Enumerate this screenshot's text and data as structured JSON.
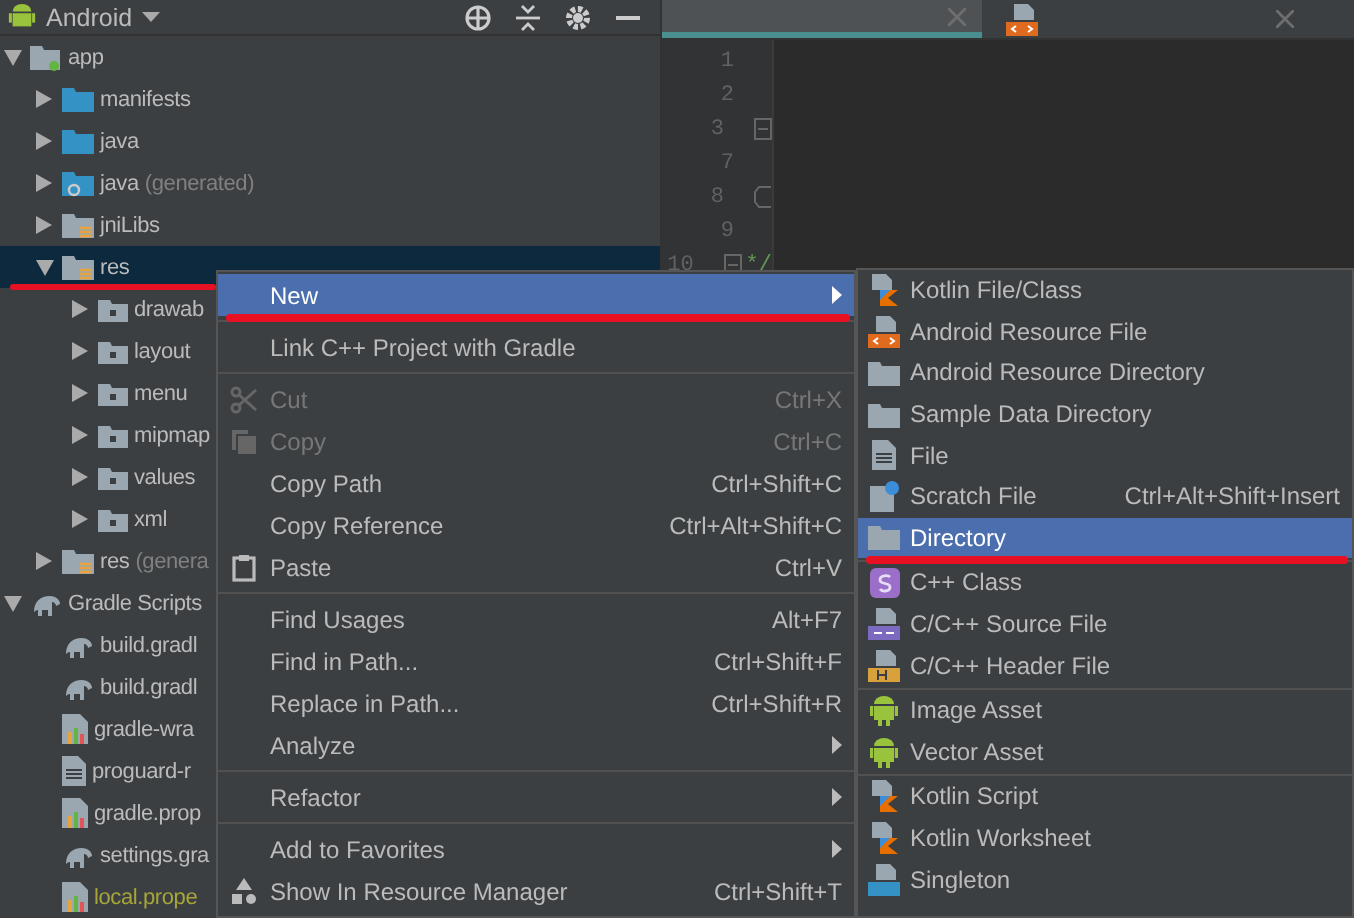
{
  "project_panel": {
    "view_selector": "Android",
    "tree": [
      {
        "label": "app",
        "kind": "module",
        "expanded": true,
        "selected": false,
        "children": [
          {
            "label": "manifests",
            "kind": "folder",
            "expanded": false,
            "selected": false
          },
          {
            "label": "java",
            "kind": "folder",
            "expanded": false,
            "selected": false
          },
          {
            "label": "java",
            "hint": "(generated)",
            "kind": "folder-generated",
            "expanded": false,
            "selected": false
          },
          {
            "label": "jniLibs",
            "kind": "folder-resource",
            "expanded": false,
            "selected": false
          },
          {
            "label": "res",
            "kind": "folder-resource",
            "expanded": true,
            "selected": true,
            "annotated": true,
            "children": [
              {
                "label": "drawab",
                "kind": "package",
                "expanded": false,
                "selected": false
              },
              {
                "label": "layout",
                "kind": "package",
                "expanded": false,
                "selected": false
              },
              {
                "label": "menu",
                "kind": "package",
                "expanded": false,
                "selected": false
              },
              {
                "label": "mipmap",
                "kind": "package",
                "expanded": false,
                "selected": false
              },
              {
                "label": "values",
                "kind": "package",
                "expanded": false,
                "selected": false
              },
              {
                "label": "xml",
                "kind": "package",
                "expanded": false,
                "selected": false
              }
            ]
          },
          {
            "label": "res",
            "hint": "(genera",
            "kind": "folder-resource",
            "expanded": false,
            "selected": false
          }
        ]
      },
      {
        "label": "Gradle Scripts",
        "kind": "gradle",
        "expanded": true,
        "selected": false,
        "children": [
          {
            "label": "build.gradl",
            "kind": "gradle",
            "selected": false
          },
          {
            "label": "build.gradl",
            "kind": "gradle",
            "selected": false
          },
          {
            "label": "gradle-wra",
            "kind": "properties",
            "selected": false
          },
          {
            "label": "proguard-r",
            "kind": "file",
            "selected": false
          },
          {
            "label": "gradle.prop",
            "kind": "properties",
            "selected": false
          },
          {
            "label": "settings.gra",
            "kind": "gradle",
            "selected": false
          },
          {
            "label": "local.prope",
            "kind": "properties",
            "selected": false,
            "ignored": true
          }
        ]
      }
    ]
  },
  "editor": {
    "tabs": [
      {
        "selected": true,
        "kind": "plain"
      },
      {
        "selected": false,
        "kind": "xml"
      }
    ],
    "lines": [
      {
        "number": "1",
        "kind": "plain"
      },
      {
        "number": "2",
        "kind": "plain"
      },
      {
        "number": "3",
        "kind": "fold-start"
      },
      {
        "number": "7",
        "kind": "plain"
      },
      {
        "number": "8",
        "kind": "fold-close"
      },
      {
        "number": "9",
        "kind": "plain"
      },
      {
        "number": "10",
        "kind": "fold-start",
        "code": "*/"
      }
    ]
  },
  "context_menu": {
    "items": [
      {
        "kind": "plain",
        "label": "New",
        "submenu": true,
        "selected": true,
        "disabled": false,
        "annotated": true
      },
      {
        "kind": "separator"
      },
      {
        "kind": "plain",
        "label": "Link C++ Project with Gradle",
        "selected": false,
        "disabled": false
      },
      {
        "kind": "separator"
      },
      {
        "kind": "scissors",
        "label": "Cut",
        "shortcut": "Ctrl+X",
        "selected": false,
        "disabled": true
      },
      {
        "kind": "copy",
        "label": "Copy",
        "shortcut": "Ctrl+C",
        "selected": false,
        "disabled": true
      },
      {
        "kind": "plain",
        "label": "Copy Path",
        "shortcut": "Ctrl+Shift+C",
        "selected": false,
        "disabled": false
      },
      {
        "kind": "plain",
        "label": "Copy Reference",
        "shortcut": "Ctrl+Alt+Shift+C",
        "selected": false,
        "disabled": false
      },
      {
        "kind": "clipboard",
        "label": "Paste",
        "shortcut": "Ctrl+V",
        "selected": false,
        "disabled": false
      },
      {
        "kind": "separator"
      },
      {
        "kind": "plain",
        "label": "Find Usages",
        "shortcut": "Alt+F7",
        "selected": false,
        "disabled": false
      },
      {
        "kind": "plain",
        "label": "Find in Path...",
        "shortcut": "Ctrl+Shift+F",
        "selected": false,
        "disabled": false
      },
      {
        "kind": "plain",
        "label": "Replace in Path...",
        "shortcut": "Ctrl+Shift+R",
        "selected": false,
        "disabled": false
      },
      {
        "kind": "plain",
        "label": "Analyze",
        "submenu": true,
        "selected": false,
        "disabled": false
      },
      {
        "kind": "separator"
      },
      {
        "kind": "plain",
        "label": "Refactor",
        "submenu": true,
        "selected": false,
        "disabled": false
      },
      {
        "kind": "separator"
      },
      {
        "kind": "plain",
        "label": "Add to Favorites",
        "submenu": true,
        "selected": false,
        "disabled": false
      },
      {
        "kind": "shapes",
        "label": "Show In Resource Manager",
        "shortcut": "Ctrl+Shift+T",
        "selected": false,
        "disabled": false
      },
      {
        "kind": "separator"
      }
    ]
  },
  "new_submenu": {
    "items": [
      {
        "kind": "kotlin",
        "label": "Kotlin File/Class",
        "selected": false
      },
      {
        "kind": "xml",
        "label": "Android Resource File",
        "selected": false
      },
      {
        "kind": "folder",
        "label": "Android Resource Directory",
        "selected": false
      },
      {
        "kind": "folder",
        "label": "Sample Data Directory",
        "selected": false
      },
      {
        "kind": "file",
        "label": "File",
        "selected": false
      },
      {
        "kind": "scratch",
        "label": "Scratch File",
        "shortcut": "Ctrl+Alt+Shift+Insert",
        "selected": false
      },
      {
        "kind": "folder",
        "label": "Directory",
        "selected": true,
        "annotated": true
      },
      {
        "kind": "separator"
      },
      {
        "kind": "cpp-class",
        "label": "C++ Class",
        "selected": false
      },
      {
        "kind": "cpp-source",
        "label": "C/C++ Source File",
        "selected": false
      },
      {
        "kind": "cpp-header",
        "label": "C/C++ Header File",
        "selected": false
      },
      {
        "kind": "separator"
      },
      {
        "kind": "android",
        "label": "Image Asset",
        "selected": false
      },
      {
        "kind": "android",
        "label": "Vector Asset",
        "selected": false
      },
      {
        "kind": "separator"
      },
      {
        "kind": "kotlin",
        "label": "Kotlin Script",
        "selected": false
      },
      {
        "kind": "kotlin",
        "label": "Kotlin Worksheet",
        "selected": false
      },
      {
        "kind": "singleton",
        "label": "Singleton",
        "selected": false
      }
    ]
  }
}
